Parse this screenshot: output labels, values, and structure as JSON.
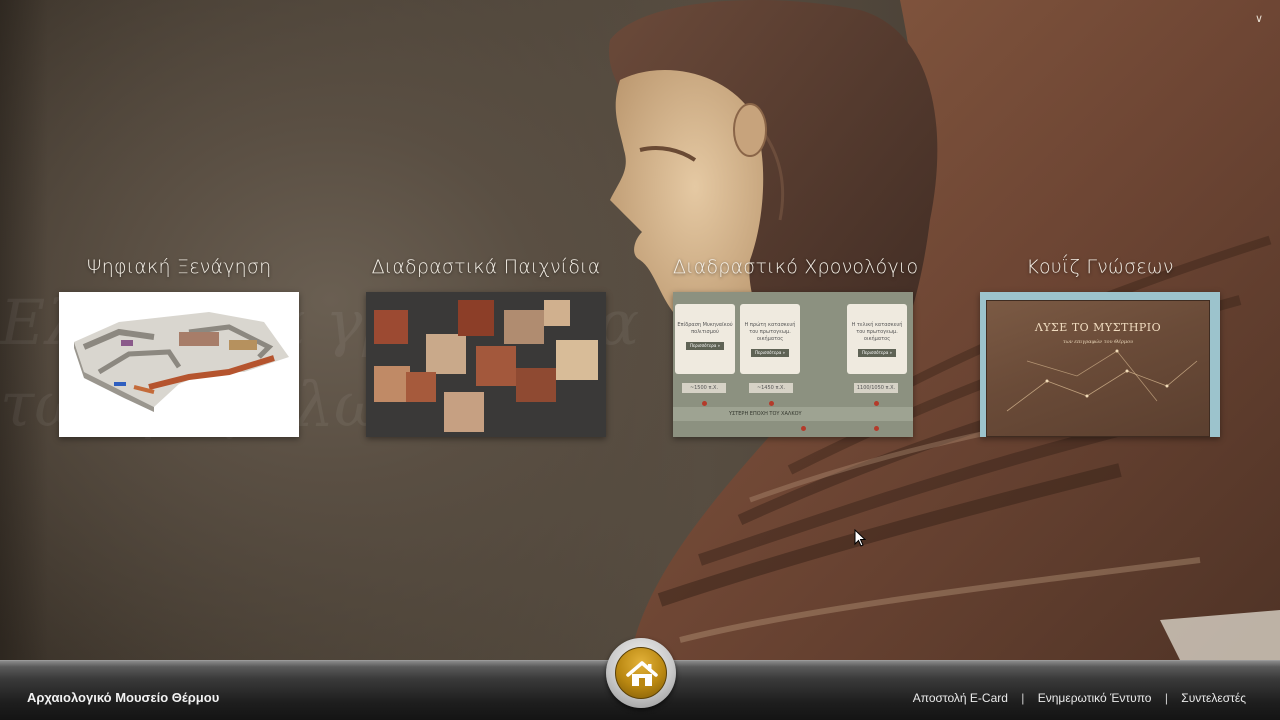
{
  "app": {
    "title": "Αρχαιολογικό Μουσείο Θέρμου"
  },
  "colors": {
    "background": "#4a4136",
    "footer": "#1e1e1e",
    "home_button": "#c99a1f"
  },
  "background_script": "Ελληνικά γράμματα\nτων μεγάλων θεών",
  "tiles": [
    {
      "label": "Ψηφιακή Ξενάγηση",
      "icon": "museum-floorplan-3d"
    },
    {
      "label": "Διαδραστικά Παιχνίδια",
      "icon": "jigsaw-puzzle"
    },
    {
      "label": "Διαδραστικό Χρονολόγιο",
      "icon": "timeline",
      "cards": [
        {
          "text": "Επίδραση Μυκηναϊκού πολιτισμού",
          "button": "Περισσότερα »"
        },
        {
          "text": "Η πρώτη κατασκευή του πρωτογεωμ. οικήματος",
          "button": "Περισσότερα »"
        },
        {
          "text": "Η τελική κατασκευή του πρωτογεωμ. οικήματος",
          "button": "Περισσότερα »"
        }
      ],
      "dates": [
        "~1500 π.Χ.",
        "~1450 π.Χ.",
        "1100/1050 π.Χ."
      ],
      "band": "ΥΣΤΕΡΗ ΕΠΟΧΗ ΤΟΥ ΧΑΛΚΟΥ"
    },
    {
      "label": "Κουΐζ Γνώσεων",
      "icon": "quiz-mystery",
      "panel_title": "ΛΥΣΕ ΤΟ ΜΥΣΤΗΡΙΟ",
      "panel_subtitle": "των επιγραφών του Θέρμου"
    }
  ],
  "footer": {
    "title": "Αρχαιολογικό Μουσείο Θέρμου",
    "links": [
      "Αποστολή E-Card",
      "Ενημερωτικό Έντυπο",
      "Συντελεστές"
    ],
    "separator": "|",
    "home_icon": "home-icon"
  },
  "top_right_icon": "chevron-down-icon"
}
